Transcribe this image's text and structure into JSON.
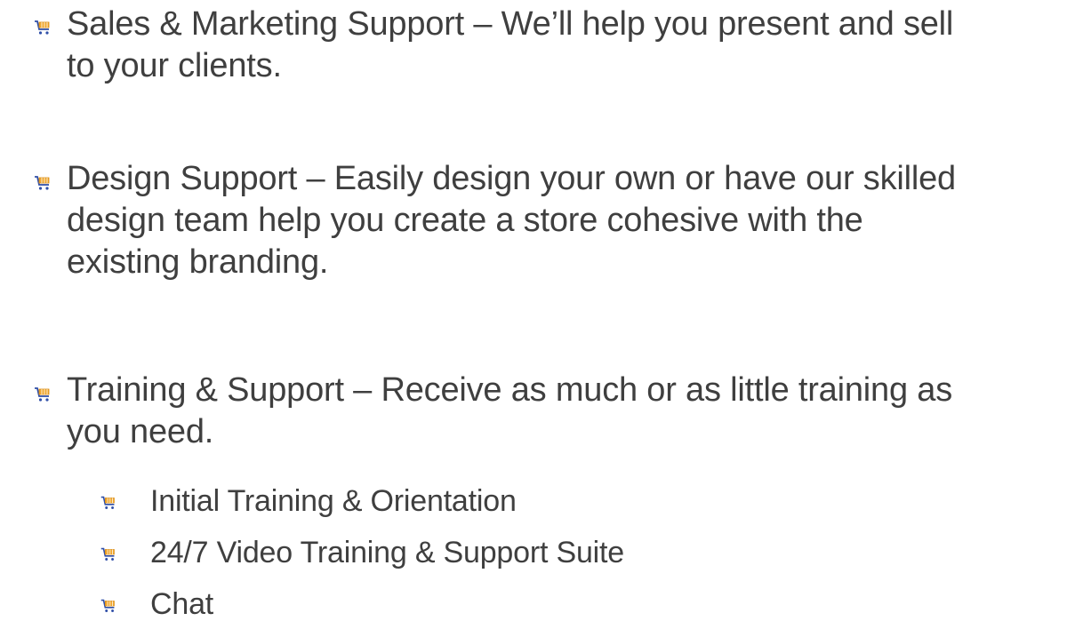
{
  "bullets": [
    {
      "icon": "shopping-cart-icon",
      "lines": [
        "Sales & Marketing Support – We’ll help you present and sell",
        "to your clients."
      ]
    },
    {
      "icon": "shopping-cart-icon",
      "lines": [
        "Design Support – Easily design your own or have our skilled",
        "design team help you create a store cohesive with the",
        "existing branding."
      ]
    },
    {
      "icon": "shopping-cart-icon",
      "lines": [
        "Training & Support – Receive as much or as little training as",
        "you need."
      ],
      "sub_items": [
        "Initial Training & Orientation",
        "24/7 Video Training & Support Suite",
        "Chat"
      ]
    }
  ],
  "colors": {
    "text": "#3f3f3f",
    "icon_orange": "#f0a830",
    "icon_blue": "#2f4fa8"
  }
}
